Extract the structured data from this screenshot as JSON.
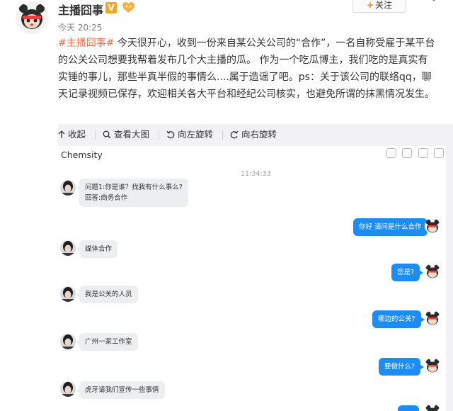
{
  "post": {
    "username": "主播囧事",
    "verified_badge": "V",
    "timestamp": "今天 20:25",
    "follow_label": "关注",
    "follow_plus": "+",
    "tag": "#主播囧事#",
    "text": " 今天很开心，收到一份来自某公关公司的“合作”，一名自称受雇于某平台的公关公司想要我帮着发布几个大主播的瓜。 作为一个吃瓜博主，我们吃的是真实有实锤的事儿，那些半真半假的事情么....属于造谣了吧。ps：关于该公司的联络qq，聊天记录视频已保存，欢迎相关各大平台和经纪公司核实，也避免所谓的抹黑情况发生。"
  },
  "media_toolbar": {
    "collapse": "收起",
    "view_large": "查看大图",
    "rotate_left": "向左旋转",
    "rotate_right": "向右旋转"
  },
  "chat": {
    "title": "Chemsity",
    "time": "11:34:33",
    "messages": [
      {
        "side": "in",
        "lines": [
          "问题1:你是谁？找我有什么事么?",
          "回答:商务合作"
        ]
      },
      {
        "side": "out",
        "lines": [
          "你好 请问是什么合作"
        ]
      },
      {
        "side": "in",
        "lines": [
          "媒体合作"
        ]
      },
      {
        "side": "out",
        "lines": [
          "您是?"
        ]
      },
      {
        "side": "in",
        "lines": [
          "我是公关的人员"
        ]
      },
      {
        "side": "out",
        "lines": [
          "哪边的公关?"
        ]
      },
      {
        "side": "in",
        "lines": [
          "广州一家工作室"
        ]
      },
      {
        "side": "out",
        "lines": [
          "要做什么?"
        ]
      },
      {
        "side": "in",
        "lines": [
          "虎牙请我们宣传一些事情"
        ]
      }
    ]
  },
  "colors": {
    "tag": "#eb7350",
    "outgoing_bubble": "#1e8df3",
    "incoming_bubble": "#eceef0",
    "verified": "#f5a623",
    "follow_plus": "#ff8200"
  },
  "icons": [
    "user-avatar",
    "verified-icon",
    "fans-badge-icon",
    "more-icon",
    "collapse-arrow-icon",
    "search-icon",
    "rotate-left-icon",
    "rotate-right-icon"
  ]
}
